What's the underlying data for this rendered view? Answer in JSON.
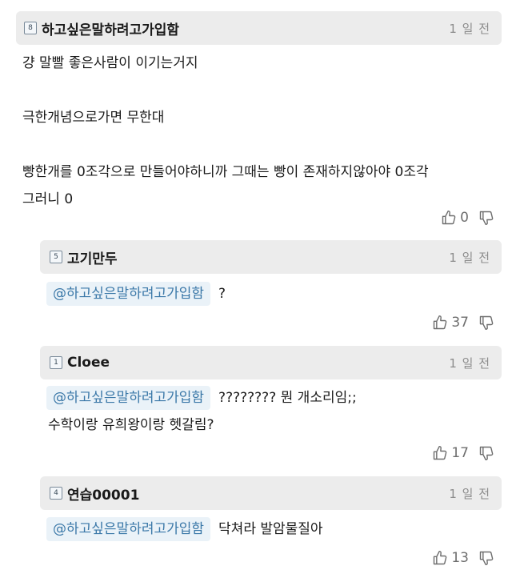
{
  "comments": [
    {
      "level": "8",
      "username": "하고싶은말하려고가입함",
      "time": "1 일 전",
      "lines": [
        "걍 말빨 좋은사람이 이기는거지",
        "",
        "극한개념으로가면 무한대",
        "",
        "빵한개를 0조각으로 만들어야하니까 그때는 빵이 존재하지않아야 0조각",
        "그러니 0"
      ],
      "likes": "0"
    },
    {
      "level": "5",
      "username": "고기만두",
      "time": "1 일 전",
      "mention": "@하고싶은말하려고가입함",
      "text": "?",
      "likes": "37"
    },
    {
      "level": "1",
      "username": "Cloee",
      "time": "1 일 전",
      "mention": "@하고싶은말하려고가입함",
      "text": "???????? 뭔 개소리임;;",
      "text2": "수학이랑 유희왕이랑 헷갈림?",
      "likes": "17"
    },
    {
      "level": "4",
      "username": "연습00001",
      "time": "1 일 전",
      "mention": "@하고싶은말하려고가입함",
      "text": "닥쳐라 발암물질아",
      "likes": "13"
    }
  ],
  "icons": {
    "like": "thumbs-up-icon",
    "dislike": "thumbs-down-icon"
  }
}
